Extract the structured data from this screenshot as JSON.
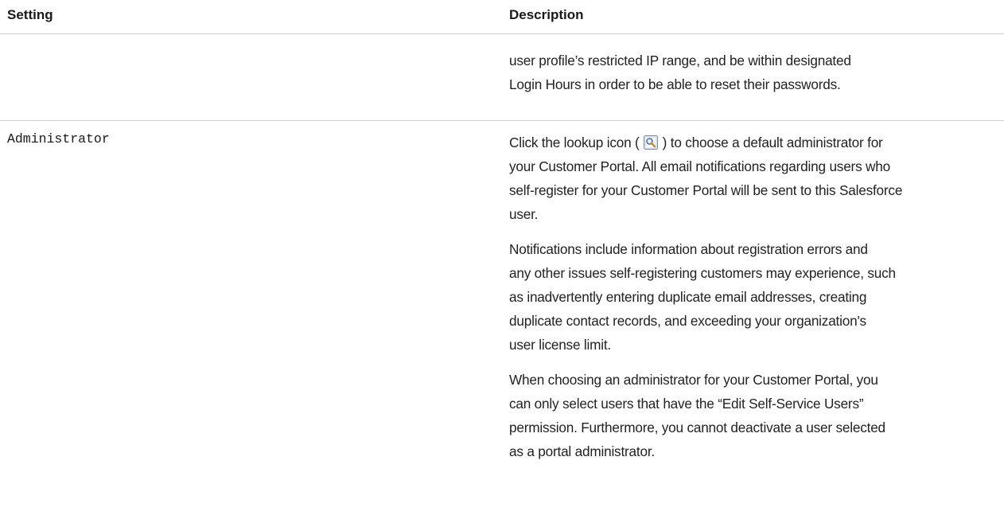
{
  "table": {
    "header": {
      "setting": "Setting",
      "description": "Description"
    },
    "rows": [
      {
        "setting": "",
        "paragraphs": [
          {
            "lines": [
              "user profile’s restricted IP range, and be within designated",
              "Login Hours in order to be able to reset their passwords."
            ]
          }
        ]
      },
      {
        "setting": "Administrator",
        "paragraphs": [
          {
            "lines_before_icon": "Click the lookup icon ( ",
            "icon": "lookup-icon",
            "lines_after_icon": " ) to choose a default administrator for",
            "lines": [
              "your Customer Portal. All email notifications regarding users who",
              "self-register for your Customer Portal will be sent to this Salesforce",
              "user."
            ]
          },
          {
            "lines": [
              "Notifications include information about registration errors and",
              "any other issues self-registering customers may experience, such",
              "as inadvertently entering duplicate email addresses, creating",
              "duplicate contact records, and exceeding your organization's",
              "user license limit."
            ]
          },
          {
            "lines": [
              "When choosing an administrator for your Customer Portal, you",
              "can only select users that have the “Edit Self-Service Users”",
              "permission. Furthermore, you cannot deactivate a user selected",
              "as a portal administrator."
            ]
          }
        ]
      }
    ]
  }
}
